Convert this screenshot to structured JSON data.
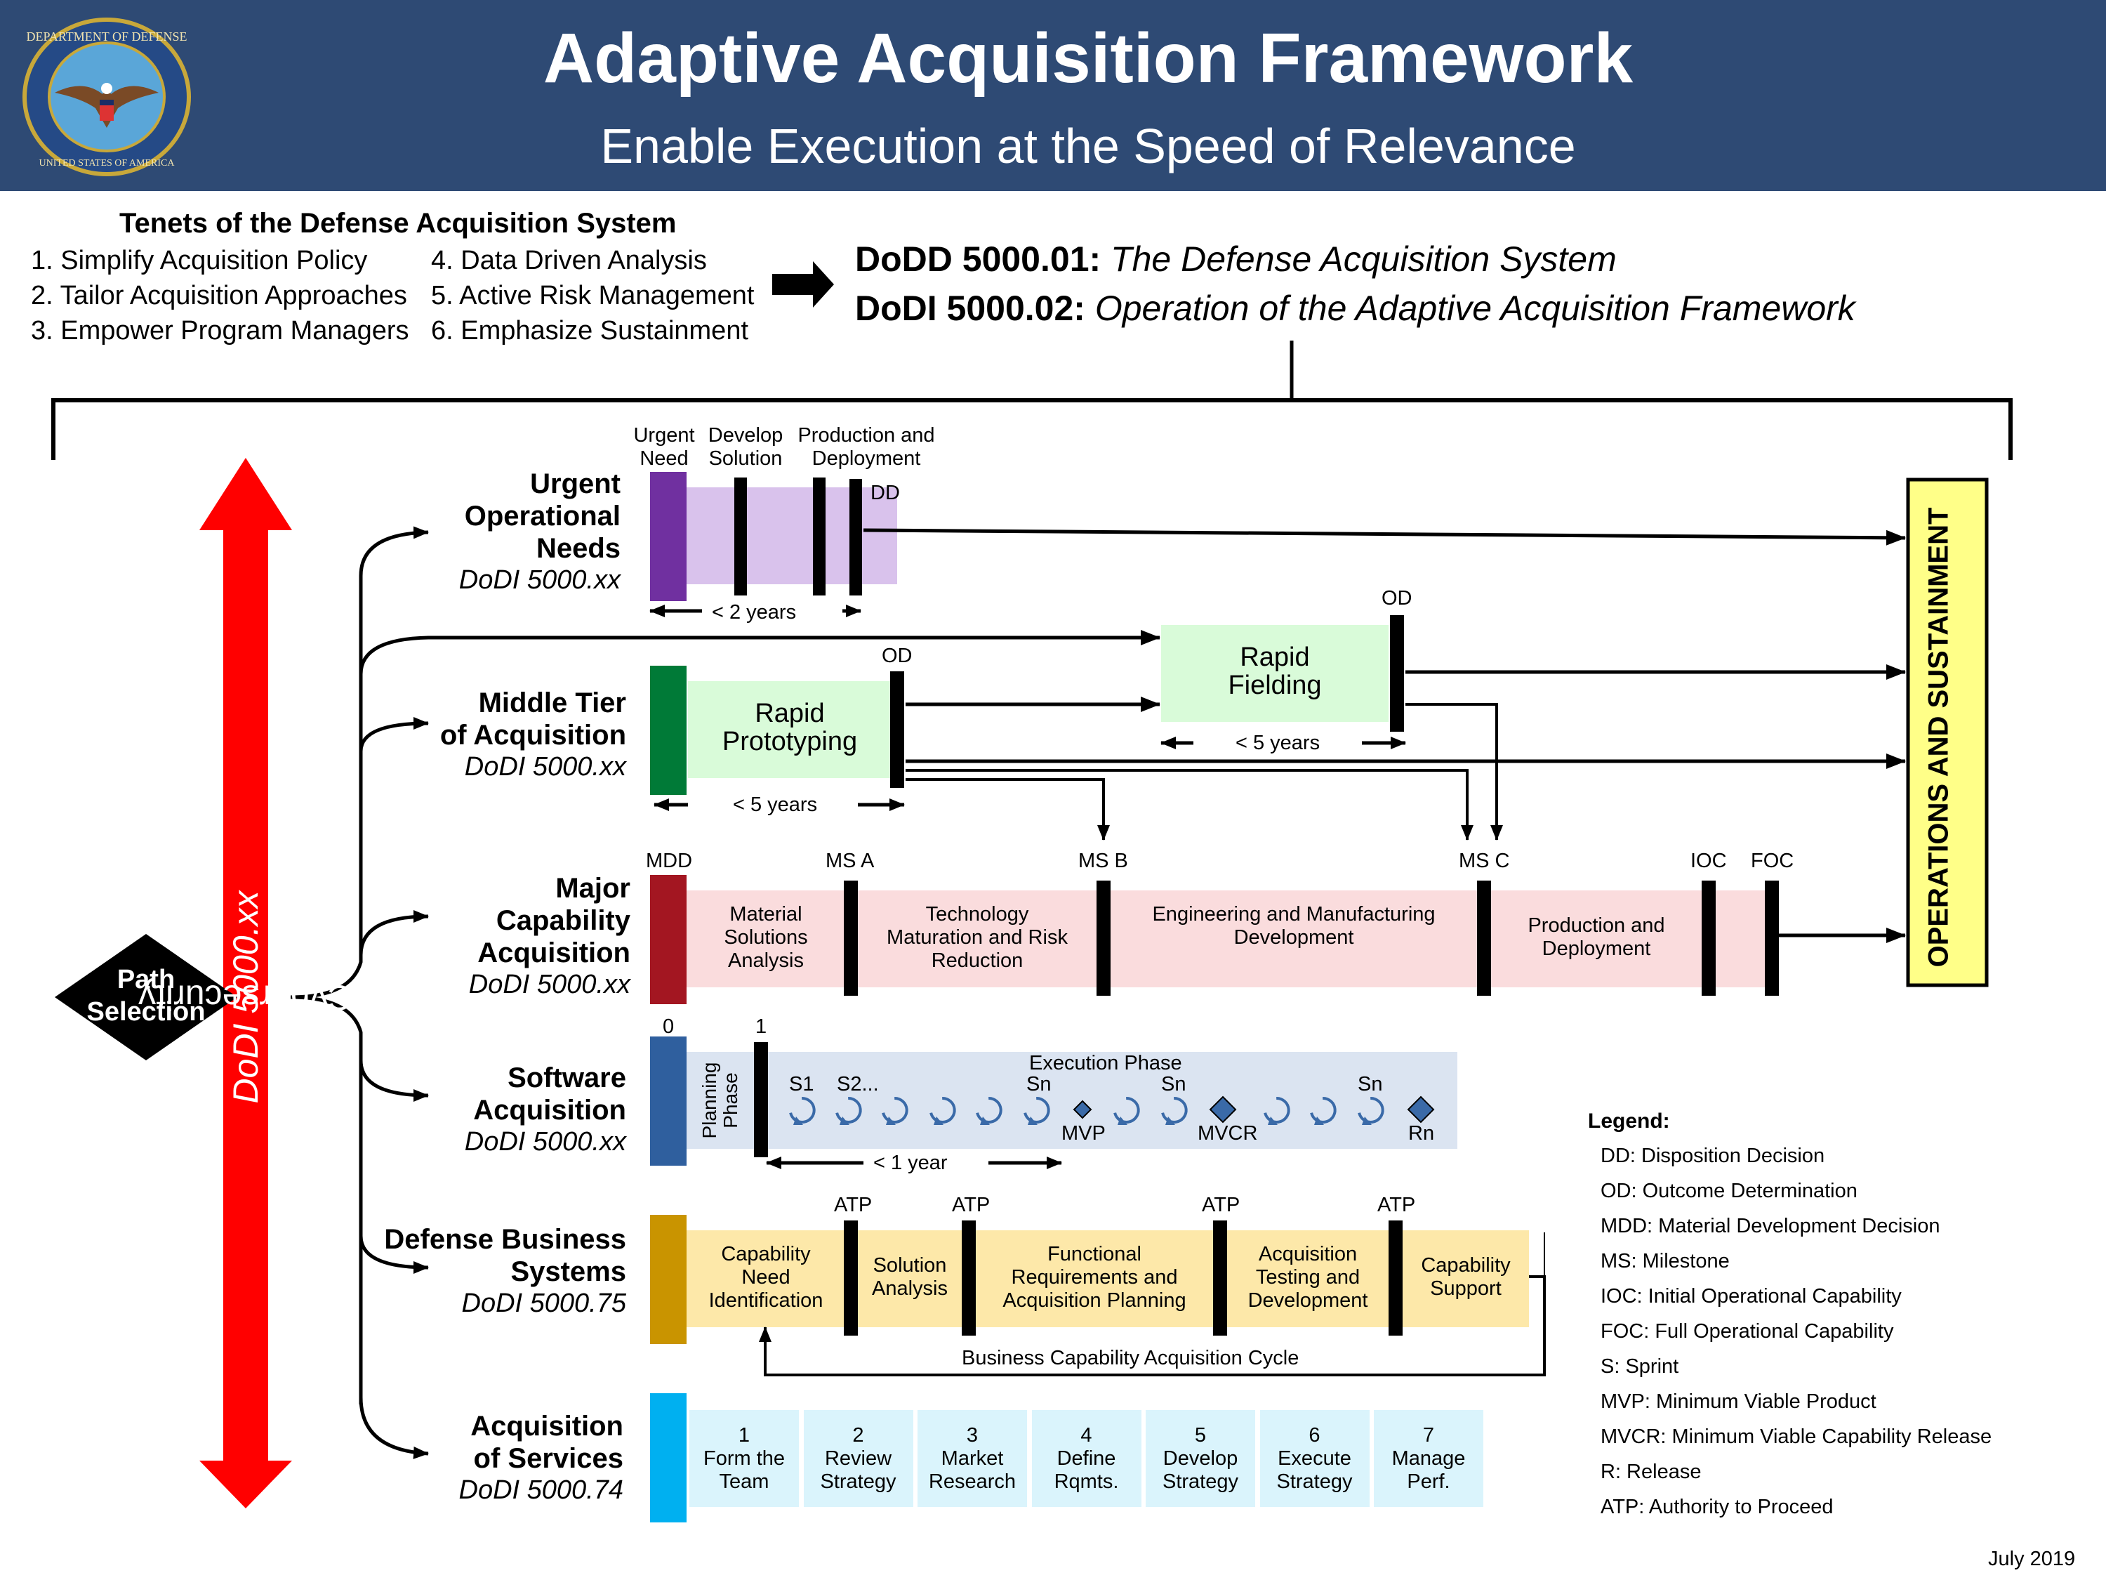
{
  "header": {
    "title": "Adaptive Acquisition Framework",
    "subtitle": "Enable Execution at the Speed of Relevance",
    "seal": "department-of-defense-seal",
    "colors": {
      "header_bg": "#2e4a74"
    }
  },
  "tenets": {
    "title": "Tenets of the Defense Acquisition System",
    "items": [
      "1. Simplify Acquisition Policy",
      "2. Tailor Acquisition Approaches",
      "3. Empower Program Managers",
      "4. Data Driven Analysis",
      "5. Active Risk Management",
      "6. Emphasize Sustainment"
    ]
  },
  "policy_docs": [
    {
      "id": "DoDD 5000.01:",
      "name": "The Defense Acquisition System"
    },
    {
      "id": "DoDI 5000.02:",
      "name": "Operation of the Adaptive Acquisition Framework"
    }
  ],
  "path_selection": {
    "label_line1": "Path",
    "label_line2": "Selection"
  },
  "cybersecurity": {
    "label": "Cybersecurity",
    "ref": "DoDI 5000.xx",
    "color": "#ff0000"
  },
  "operations_sustainment": {
    "label": "OPERATIONS AND SUSTAINMENT",
    "color": "#ffff88"
  },
  "paths": {
    "uon": {
      "name": [
        "Urgent",
        "Operational",
        "Needs"
      ],
      "ref": "DoDI 5000.xx",
      "color": "#7030a0",
      "fill": "#d9c2ec",
      "phase_headers": [
        [
          "Urgent",
          "Need"
        ],
        [
          "Develop",
          "Solution"
        ],
        [
          "Production and",
          "Deployment"
        ]
      ],
      "decision": "DD",
      "duration": "< 2 years"
    },
    "mta": {
      "name": [
        "Middle Tier",
        "of Acquisition"
      ],
      "ref": "DoDI 5000.xx",
      "color": "#007a37",
      "fill": "#d9fbd9",
      "prototyping": [
        "Rapid",
        "Prototyping"
      ],
      "fielding": [
        "Rapid",
        "Fielding"
      ],
      "decision": "OD",
      "duration_prototyping": "< 5 years",
      "duration_fielding": "< 5 years"
    },
    "mca": {
      "name": [
        "Major",
        "Capability",
        "Acquisition"
      ],
      "ref": "DoDI 5000.xx",
      "color": "#a31621",
      "fill": "#fadcdd",
      "milestones": [
        "MDD",
        "MS A",
        "MS B",
        "MS C",
        "IOC",
        "FOC"
      ],
      "phases": [
        [
          "Material",
          "Solutions",
          "Analysis"
        ],
        [
          "Technology",
          "Maturation and Risk",
          "Reduction"
        ],
        [
          "Engineering and Manufacturing",
          "Development"
        ],
        [
          "Production and",
          "Deployment"
        ]
      ]
    },
    "software": {
      "name": [
        "Software",
        "Acquisition"
      ],
      "ref": "DoDI 5000.xx",
      "color": "#2f5f9e",
      "fill": "#dbe4f1",
      "marker_0": "0",
      "marker_1": "1",
      "planning_phase": [
        "Planning",
        "Phase"
      ],
      "execution_phase": "Execution Phase",
      "sprint_labels": [
        "S1",
        "S2...",
        "Sn",
        "Sn",
        "Sn"
      ],
      "release_labels": [
        "MVP",
        "MVCR",
        "Rn"
      ],
      "duration": "< 1 year"
    },
    "dbs": {
      "name": [
        "Defense Business",
        "Systems"
      ],
      "ref": "DoDI 5000.75",
      "color": "#c99400",
      "fill": "#fde8a9",
      "atp": [
        "ATP",
        "ATP",
        "ATP",
        "ATP"
      ],
      "phases": [
        [
          "Capability",
          "Need",
          "Identification"
        ],
        [
          "Solution",
          "Analysis"
        ],
        [
          "Functional",
          "Requirements and",
          "Acquisition Planning"
        ],
        [
          "Acquisition",
          "Testing and",
          "Development"
        ],
        [
          "Capability",
          "Support"
        ]
      ],
      "cycle_label": "Business Capability Acquisition Cycle"
    },
    "aos": {
      "name": [
        "Acquisition",
        "of Services"
      ],
      "ref": "DoDI 5000.74",
      "color": "#00b0f0",
      "fill": "#daf4fc",
      "steps": [
        [
          "1",
          "Form the",
          "Team"
        ],
        [
          "2",
          "Review",
          "Strategy"
        ],
        [
          "3",
          "Market",
          "Research"
        ],
        [
          "4",
          "Define",
          "Rqmts."
        ],
        [
          "5",
          "Develop",
          "Strategy"
        ],
        [
          "6",
          "Execute",
          "Strategy"
        ],
        [
          "7",
          "Manage",
          "Perf."
        ]
      ]
    }
  },
  "legend": {
    "title": "Legend:",
    "items": [
      "DD: Disposition Decision",
      "OD: Outcome Determination",
      "MDD: Material Development Decision",
      "MS: Milestone",
      "IOC: Initial Operational Capability",
      "FOC: Full Operational Capability",
      "S: Sprint",
      "MVP: Minimum Viable Product",
      "MVCR: Minimum Viable Capability Release",
      "R: Release",
      "ATP: Authority to Proceed"
    ]
  },
  "footer": {
    "date": "July 2019"
  }
}
